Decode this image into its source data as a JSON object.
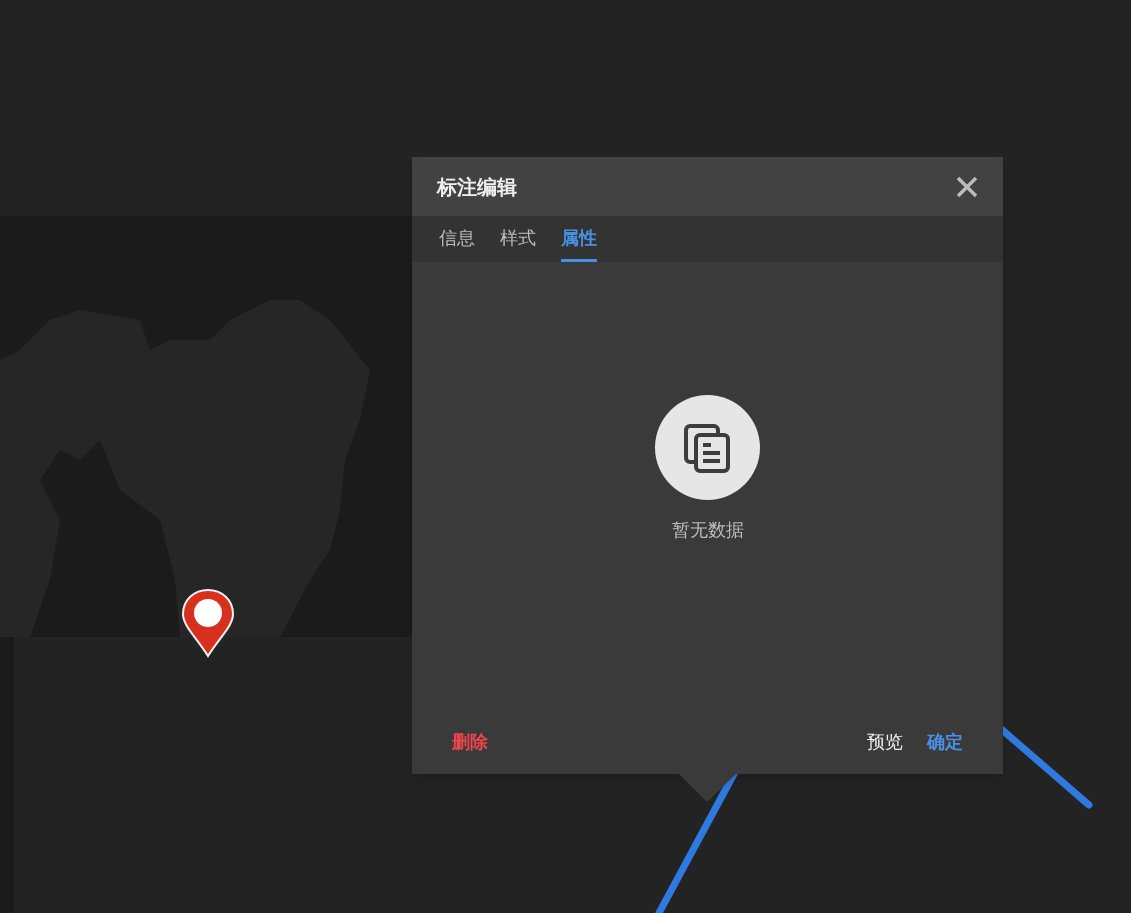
{
  "dialog": {
    "title": "标注编辑",
    "tabs": [
      {
        "label": "信息",
        "selected": false
      },
      {
        "label": "样式",
        "selected": false
      },
      {
        "label": "属性",
        "selected": true
      }
    ],
    "empty": {
      "text": "暂无数据"
    },
    "buttons": [
      {
        "label": "删除",
        "kind": "danger"
      },
      {
        "label": "预览",
        "kind": "plain"
      },
      {
        "label": "确定",
        "kind": "primary"
      }
    ]
  }
}
